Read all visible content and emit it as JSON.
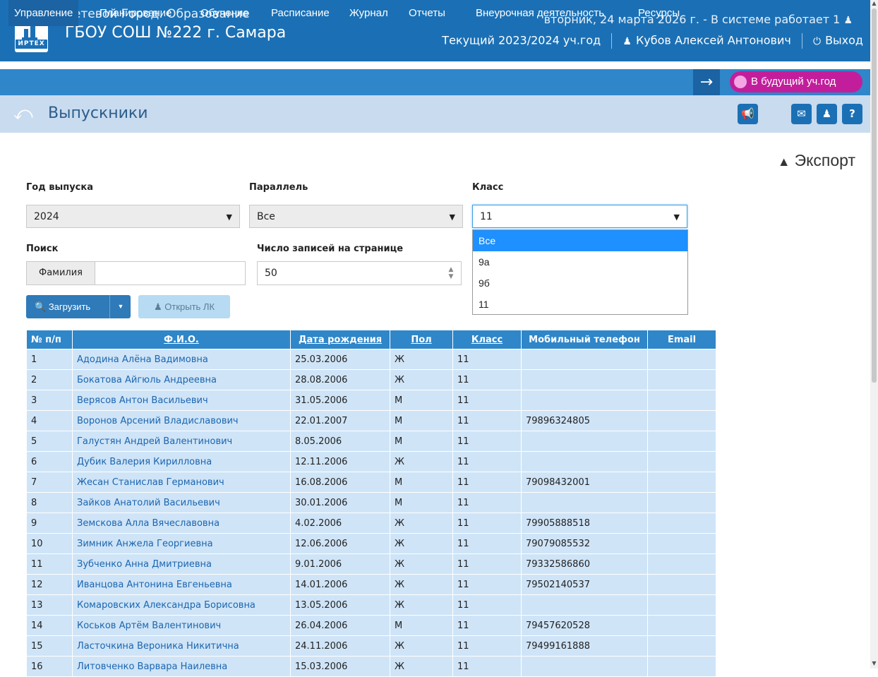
{
  "header": {
    "logo_text": "ИРТЕХ",
    "org_top": "Сетевой Город. Образование",
    "org_name": "ГБОУ СОШ №222 г. Самара",
    "date_line": "вторник, 24 марта 2026 г. - В системе работает 1",
    "year_line": "Текущий 2023/2024 уч.год",
    "user_name": "Кубов Алексей Антонович",
    "logout": "Выход"
  },
  "nav": {
    "items": [
      "Управление",
      "Планирование",
      "Обучение",
      "Расписание",
      "Журнал",
      "Отчеты",
      "Внеурочная деятельность",
      "Ресурсы"
    ],
    "active": "Управление",
    "future_year": "В будущий уч.год"
  },
  "page": {
    "title": "Выпускники",
    "export": "Экспорт"
  },
  "filters": {
    "year_label": "Год выпуска",
    "year_value": "2024",
    "parallel_label": "Параллель",
    "parallel_value": "Все",
    "class_label": "Класс",
    "class_value": "11",
    "class_options": [
      "Все",
      "9а",
      "9б",
      "11"
    ],
    "class_highlighted": "Все",
    "search_label": "Поиск",
    "search_addon": "Фамилия",
    "search_value": "",
    "per_page_label": "Число записей на странице",
    "per_page_value": "50",
    "load_button": "Загрузить",
    "open_lk_button": "Открыть ЛК"
  },
  "table": {
    "headers": [
      "№ п/п",
      "Ф.И.О.",
      "Дата рождения",
      "Пол",
      "Класс",
      "Мобильный телефон",
      "Email"
    ],
    "rows": [
      [
        "1",
        "Адодина Алёна Вадимовна",
        "25.03.2006",
        "Ж",
        "11",
        "",
        ""
      ],
      [
        "2",
        "Бокатова Айгюль Андреевна",
        "28.08.2006",
        "Ж",
        "11",
        "",
        ""
      ],
      [
        "3",
        "Верясов Антон Васильевич",
        "31.05.2006",
        "М",
        "11",
        "",
        ""
      ],
      [
        "4",
        "Воронов Арсений Владиславович",
        "22.01.2007",
        "М",
        "11",
        "79896324805",
        ""
      ],
      [
        "5",
        "Галустян Андрей Валентинович",
        "8.05.2006",
        "М",
        "11",
        "",
        ""
      ],
      [
        "6",
        "Дубик Валерия Кирилловна",
        "12.11.2006",
        "Ж",
        "11",
        "",
        ""
      ],
      [
        "7",
        "Жесан Станислав Германович",
        "16.08.2006",
        "М",
        "11",
        "79098432001",
        ""
      ],
      [
        "8",
        "Зайков Анатолий Васильевич",
        "30.01.2006",
        "М",
        "11",
        "",
        ""
      ],
      [
        "9",
        "Земскова Алла Вячеславовна",
        "4.02.2006",
        "Ж",
        "11",
        "79905888518",
        ""
      ],
      [
        "10",
        "Зимник Анжела Георгиевна",
        "12.06.2006",
        "Ж",
        "11",
        "79079085532",
        ""
      ],
      [
        "11",
        "Зубченко Анна Дмитриевна",
        "9.01.2006",
        "Ж",
        "11",
        "79332586860",
        ""
      ],
      [
        "12",
        "Иванцова Антонина Евгеньевна",
        "14.01.2006",
        "Ж",
        "11",
        "79502140537",
        ""
      ],
      [
        "13",
        "Комаровских Александра Борисовна",
        "13.05.2006",
        "Ж",
        "11",
        "",
        ""
      ],
      [
        "14",
        "Коськов Артём Валентинович",
        "26.04.2006",
        "М",
        "11",
        "79457620528",
        ""
      ],
      [
        "15",
        "Ласточкина Вероника Никитична",
        "24.11.2006",
        "Ж",
        "11",
        "79499161888",
        ""
      ],
      [
        "16",
        "Литовченко Варвара Наилевна",
        "15.03.2006",
        "Ж",
        "11",
        "",
        ""
      ]
    ]
  },
  "colors": {
    "header_bg": "#1b70b5",
    "nav_bg": "#2f86c9",
    "title_bar_bg": "#c9dbef",
    "future_badge": "#c21e9b",
    "row_bg": "#cfe4f7",
    "link": "#1b66b0"
  }
}
